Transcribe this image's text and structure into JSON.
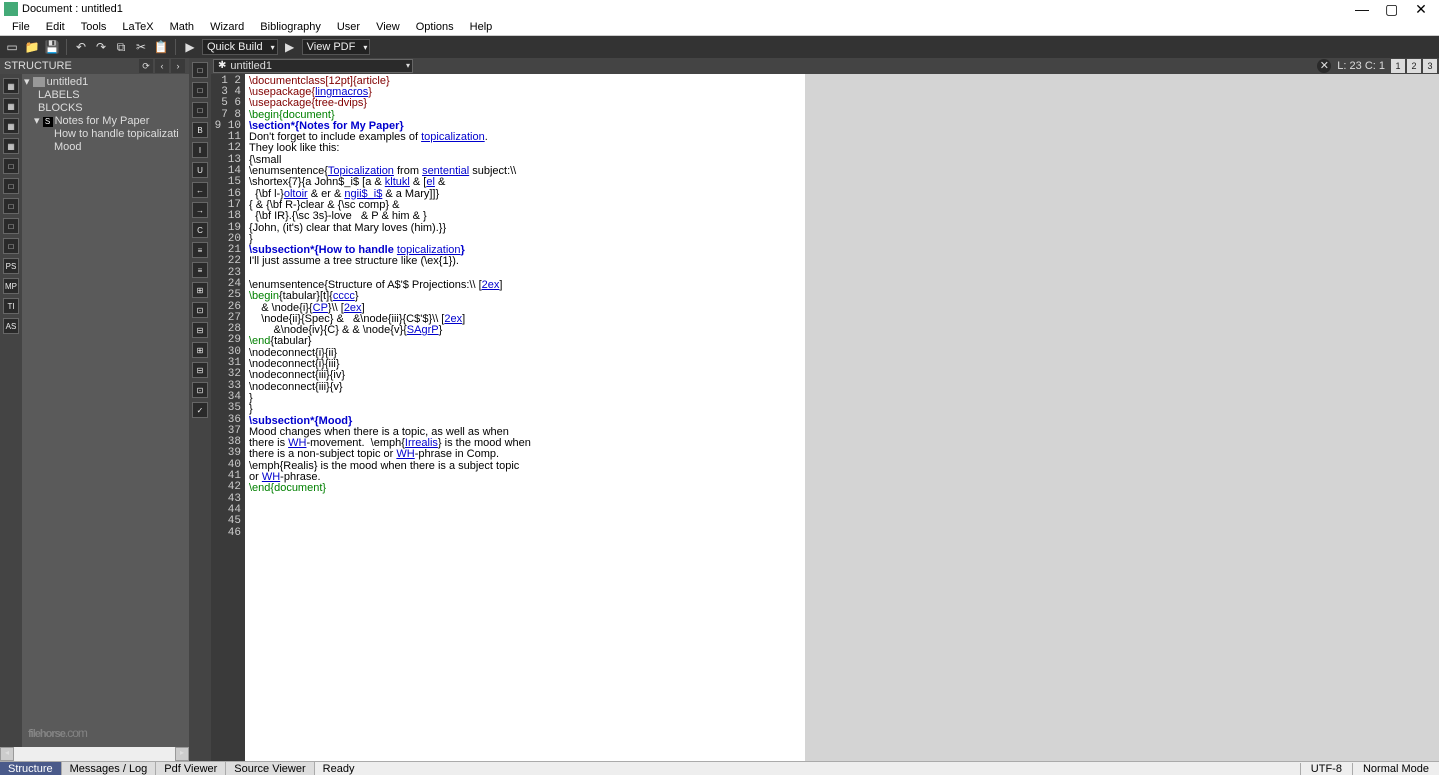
{
  "title": "Document : untitled1",
  "menus": [
    "File",
    "Edit",
    "Tools",
    "LaTeX",
    "Math",
    "Wizard",
    "Bibliography",
    "User",
    "View",
    "Options",
    "Help"
  ],
  "toolbar": {
    "quickbuild": "Quick Build",
    "viewpdf": "View PDF"
  },
  "structure": {
    "header": "STRUCTURE",
    "doc": "untitled1",
    "labels": "LABELS",
    "blocks": "BLOCKS",
    "items": [
      {
        "label": "Notes for My Paper",
        "indent": 0
      },
      {
        "label": "How to handle topicalizati",
        "indent": 1
      },
      {
        "label": "Mood",
        "indent": 1
      }
    ]
  },
  "leftbar1": [
    "▦",
    "▦",
    "▦",
    "▦",
    "□",
    "□",
    "□",
    "□",
    "□",
    "PS",
    "MP",
    "TI",
    "AS"
  ],
  "leftbar2": [
    "□",
    "□",
    "□",
    "B",
    "I",
    "U",
    "←",
    "→",
    "C",
    "≡",
    "≡",
    "⊞",
    "⊡",
    "⊟",
    "⊞",
    "⊟",
    "⊡",
    "✓"
  ],
  "tabbar": {
    "file": "untitled1",
    "cursor": "L: 23 C: 1",
    "panes": [
      "1",
      "2",
      "3"
    ]
  },
  "gutter_start": 1,
  "gutter_end": 46,
  "code_lines": [
    {
      "t": "\\documentclass[12pt]{article}",
      "c": "cmd"
    },
    {
      "t": "\\usepackage{",
      "c": "cmd",
      "u": "lingmacros",
      "t2": "}"
    },
    {
      "t": "\\usepackage{tree-dvips}",
      "c": "cmd"
    },
    {
      "t": "\\begin{document}",
      "c": "kw"
    },
    {
      "t": ""
    },
    {
      "t": "\\section*{Notes for My Paper}",
      "c": "sec"
    },
    {
      "t": ""
    },
    {
      "raw": "Don't forget to include examples of <span class='ul'>topicalization</span>."
    },
    {
      "raw": "They look like this:"
    },
    {
      "t": ""
    },
    {
      "raw": "{\\small"
    },
    {
      "raw": "\\enumsentence{<span class='ul'>Topicalization</span> from <span class='ul'>sentential</span> subject:\\\\"
    },
    {
      "raw": "\\shortex{7}{a John$_i$ [a & <span class='ul'>kltukl</span> & [<span class='ul'>el</span> &"
    },
    {
      "raw": "  {\\bf l-}<span class='ul'>oltoir</span> & er & <span class='ul'>ngii$_i$</span> & a Mary]]}"
    },
    {
      "raw": "{ & {\\bf R-}clear & {\\sc comp} &"
    },
    {
      "raw": "  {\\bf IR}.{\\sc 3s}-love   & P & him & }"
    },
    {
      "raw": "{John, (it's) clear that Mary loves (him).}}"
    },
    {
      "raw": "}"
    },
    {
      "t": ""
    },
    {
      "raw": "<span class='sec'>\\subsection*{How to handle </span><span class='ul'>topicalization</span><span class='sec'>}</span>"
    },
    {
      "t": ""
    },
    {
      "raw": "I'll just assume a tree structure like (\\ex{1})."
    },
    {
      "t": "",
      "hl": true
    },
    {
      "raw": "{\\small",
      "hl": true
    },
    {
      "raw": "\\enumsentence{Structure of A$'$ Projections:\\\\ [<span class='ul'>2ex</span>]"
    },
    {
      "raw": "<span class='kw'>\\begin</span>{tabular}[t]{<span class='ul'>cccc</span>}"
    },
    {
      "raw": "    & \\node{i}{<span class='ul'>CP</span>}\\\\ [<span class='ul'>2ex</span>]"
    },
    {
      "raw": "    \\node{ii}{Spec} &   &\\node{iii}{C$'$}\\\\ [<span class='ul'>2ex</span>]"
    },
    {
      "raw": "        &\\node{iv}{C} & & \\node{v}{<span class='ul'>SAgrP</span>}"
    },
    {
      "raw": "<span class='kw'>\\end</span>{tabular}"
    },
    {
      "raw": "\\nodeconnect{i}{ii}"
    },
    {
      "raw": "\\nodeconnect{i}{iii}"
    },
    {
      "raw": "\\nodeconnect{iii}{iv}"
    },
    {
      "raw": "\\nodeconnect{iii}{v}"
    },
    {
      "raw": "}"
    },
    {
      "raw": "}"
    },
    {
      "t": ""
    },
    {
      "t": "\\subsection*{Mood}",
      "c": "sec"
    },
    {
      "t": ""
    },
    {
      "raw": "Mood changes when there is a topic, as well as when"
    },
    {
      "raw": "there is <span class='ul'>WH</span>-movement.  \\emph{<span class='ul'>Irrealis</span>} is the mood when"
    },
    {
      "raw": "there is a non-subject topic or <span class='ul'>WH</span>-phrase in Comp."
    },
    {
      "raw": "\\emph{Realis} is the mood when there is a subject topic"
    },
    {
      "raw": "or <span class='ul'>WH</span>-phrase."
    },
    {
      "t": ""
    },
    {
      "t": "\\end{document}",
      "c": "kw"
    }
  ],
  "statusbar": {
    "tabs": [
      "Structure",
      "Messages / Log",
      "Pdf Viewer",
      "Source Viewer"
    ],
    "active": 0,
    "ready": "Ready",
    "encoding": "UTF-8",
    "mode": "Normal Mode"
  },
  "watermark": "filehorse",
  "watermark_dom": ".com"
}
